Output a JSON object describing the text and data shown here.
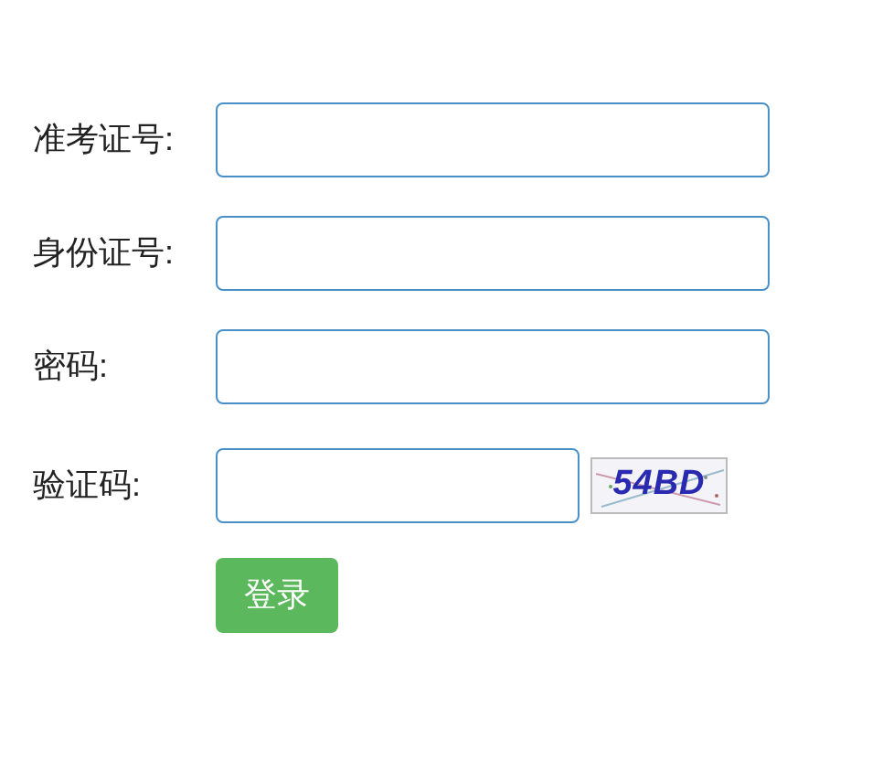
{
  "fields": [
    {
      "label": "准考证号:",
      "kind": "text"
    },
    {
      "label": "身份证号:",
      "kind": "text"
    },
    {
      "label": "密码:",
      "kind": "text"
    },
    {
      "label": "验证码:",
      "kind": "captcha",
      "captcha": "54BD"
    }
  ],
  "submit": "登录"
}
